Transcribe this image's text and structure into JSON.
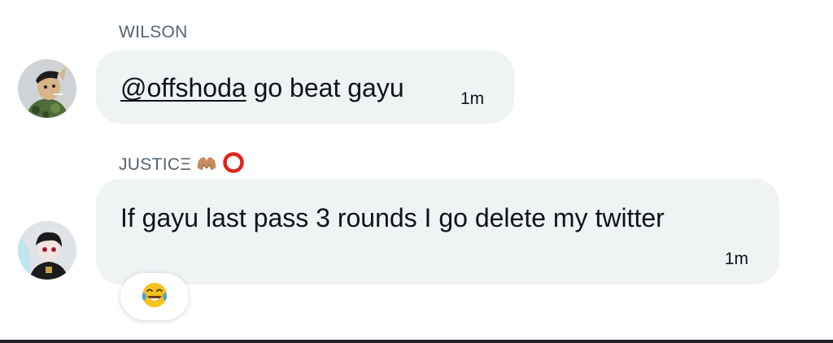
{
  "messages": [
    {
      "sender": "WILSON",
      "avatar_icon": "user-avatar-icon",
      "mention": "@offshoda",
      "text": " go beat gayu",
      "time": "1m"
    },
    {
      "sender": "JUSTICΞ",
      "sender_emojis": [
        "heart-hands-icon",
        "red-circle-icon"
      ],
      "avatar_icon": "user-avatar-icon",
      "text": "If gayu last pass 3 rounds I go delete my twitter",
      "time": "1m",
      "reaction_icon": "face-with-tears-of-joy-icon"
    }
  ],
  "colors": {
    "bubble_bg": "#eff3f4",
    "sender_gray": "#536471",
    "text": "#0f1419"
  }
}
